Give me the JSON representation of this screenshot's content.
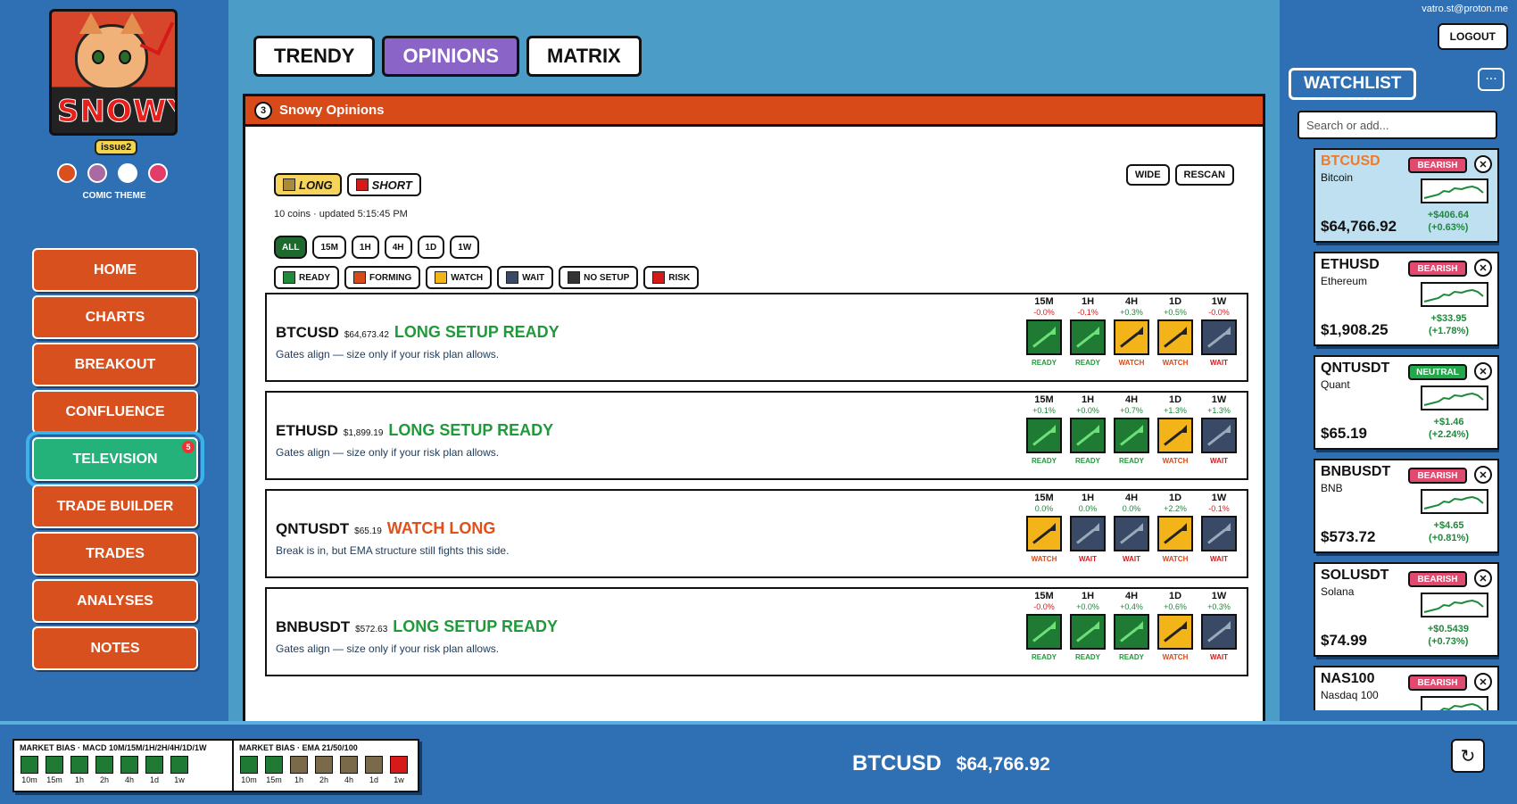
{
  "brand": {
    "logo_text": "SNOWY",
    "issue": "issue2",
    "theme_label": "COMIC THEME"
  },
  "theme_colors": [
    "#d9501f",
    "#a86aa0",
    "#ffffff",
    "#e33c6b"
  ],
  "nav": [
    {
      "label": "HOME"
    },
    {
      "label": "CHARTS"
    },
    {
      "label": "BREAKOUT"
    },
    {
      "label": "CONFLUENCE"
    },
    {
      "label": "TELEVISION",
      "active": true,
      "badge": "5"
    },
    {
      "label": "TRADE BUILDER"
    },
    {
      "label": "TRADES"
    },
    {
      "label": "ANALYSES"
    },
    {
      "label": "NOTES"
    }
  ],
  "tabs": [
    {
      "label": "TRENDY"
    },
    {
      "label": "OPINIONS",
      "active": true
    },
    {
      "label": "MATRIX"
    }
  ],
  "panel": {
    "number": "3",
    "title": "Snowy Opinions",
    "direction": {
      "long": "LONG",
      "short": "SHORT"
    },
    "wide_label": "WIDE",
    "rescan_label": "RESCAN",
    "meta": "10 coins · updated 5:15:45 PM",
    "timeframes": [
      "ALL",
      "15M",
      "1H",
      "4H",
      "1D",
      "1W"
    ],
    "filters": [
      {
        "label": "READY",
        "color": "#1f8a3a"
      },
      {
        "label": "FORMING",
        "color": "#d84a17"
      },
      {
        "label": "WATCH",
        "color": "#f3b41a"
      },
      {
        "label": "WAIT",
        "color": "#3a4a66"
      },
      {
        "label": "NO SETUP",
        "color": "#333333"
      },
      {
        "label": "RISK",
        "color": "#d61a1a"
      }
    ]
  },
  "state_colors": {
    "READY": "#1f7a33",
    "WATCH": "#f3b41a",
    "WAIT": "#3a4a66"
  },
  "coins": [
    {
      "symbol": "BTCUSD",
      "price": "$64,673.42",
      "status": "LONG SETUP READY",
      "status_color": "#1f9a3a",
      "desc": "Gates align — size only if your risk plan allows.",
      "tfs": [
        {
          "l": "15M",
          "p": "-0.0%",
          "s": "READY"
        },
        {
          "l": "1H",
          "p": "-0.1%",
          "s": "READY"
        },
        {
          "l": "4H",
          "p": "+0.3%",
          "s": "WATCH"
        },
        {
          "l": "1D",
          "p": "+0.5%",
          "s": "WATCH"
        },
        {
          "l": "1W",
          "p": "-0.0%",
          "s": "WAIT"
        }
      ]
    },
    {
      "symbol": "ETHUSD",
      "price": "$1,899.19",
      "status": "LONG SETUP READY",
      "status_color": "#1f9a3a",
      "desc": "Gates align — size only if your risk plan allows.",
      "tfs": [
        {
          "l": "15M",
          "p": "+0.1%",
          "s": "READY"
        },
        {
          "l": "1H",
          "p": "+0.0%",
          "s": "READY"
        },
        {
          "l": "4H",
          "p": "+0.7%",
          "s": "READY"
        },
        {
          "l": "1D",
          "p": "+1.3%",
          "s": "WATCH"
        },
        {
          "l": "1W",
          "p": "+1.3%",
          "s": "WAIT"
        }
      ]
    },
    {
      "symbol": "QNTUSDT",
      "price": "$65.19",
      "status": "WATCH LONG",
      "status_color": "#e2501a",
      "desc": "Break is in, but EMA structure still fights this side.",
      "tfs": [
        {
          "l": "15M",
          "p": "0.0%",
          "s": "WATCH"
        },
        {
          "l": "1H",
          "p": "0.0%",
          "s": "WAIT"
        },
        {
          "l": "4H",
          "p": "0.0%",
          "s": "WAIT"
        },
        {
          "l": "1D",
          "p": "+2.2%",
          "s": "WATCH"
        },
        {
          "l": "1W",
          "p": "-0.1%",
          "s": "WAIT"
        }
      ]
    },
    {
      "symbol": "BNBUSDT",
      "price": "$572.63",
      "status": "LONG SETUP READY",
      "status_color": "#1f9a3a",
      "desc": "Gates align — size only if your risk plan allows.",
      "tfs": [
        {
          "l": "15M",
          "p": "-0.0%",
          "s": "READY"
        },
        {
          "l": "1H",
          "p": "+0.0%",
          "s": "READY"
        },
        {
          "l": "4H",
          "p": "+0.4%",
          "s": "READY"
        },
        {
          "l": "1D",
          "p": "+0.6%",
          "s": "WATCH"
        },
        {
          "l": "1W",
          "p": "+0.3%",
          "s": "WAIT"
        }
      ]
    }
  ],
  "account": {
    "email": "vatro.st@proton.me",
    "logout": "LOGOUT"
  },
  "watchlist": {
    "title": "WATCHLIST",
    "more": "···",
    "search_placeholder": "Search or add...",
    "items": [
      {
        "symbol": "BTCUSD",
        "name": "Bitcoin",
        "badge": "BEARISH",
        "badge_color": "#e04a6f",
        "price": "$64,766.92",
        "chg1": "+$406.64",
        "chg2": "(+0.63%)",
        "selected": true
      },
      {
        "symbol": "ETHUSD",
        "name": "Ethereum",
        "badge": "BEARISH",
        "badge_color": "#e04a6f",
        "price": "$1,908.25",
        "chg1": "+$33.95",
        "chg2": "(+1.78%)"
      },
      {
        "symbol": "QNTUSDT",
        "name": "Quant",
        "badge": "NEUTRAL",
        "badge_color": "#22a84a",
        "price": "$65.19",
        "chg1": "+$1.46",
        "chg2": "(+2.24%)"
      },
      {
        "symbol": "BNBUSDT",
        "name": "BNB",
        "badge": "BEARISH",
        "badge_color": "#e04a6f",
        "price": "$573.72",
        "chg1": "+$4.65",
        "chg2": "(+0.81%)"
      },
      {
        "symbol": "SOLUSDT",
        "name": "Solana",
        "badge": "BEARISH",
        "badge_color": "#e04a6f",
        "price": "$74.99",
        "chg1": "+$0.5439",
        "chg2": "(+0.73%)"
      },
      {
        "symbol": "NAS100",
        "name": "Nasdaq 100",
        "badge": "BEARISH",
        "badge_color": "#e04a6f",
        "price": "",
        "chg1": "",
        "chg2": ""
      }
    ]
  },
  "bottom": {
    "macd": {
      "title": "MARKET BIAS · MACD 10M/15M/1H/2H/4H/1D/1W",
      "cells": [
        {
          "l": "10m",
          "c": "#1f7a33"
        },
        {
          "l": "15m",
          "c": "#1f7a33"
        },
        {
          "l": "1h",
          "c": "#1f7a33"
        },
        {
          "l": "2h",
          "c": "#1f7a33"
        },
        {
          "l": "4h",
          "c": "#1f7a33"
        },
        {
          "l": "1d",
          "c": "#1f7a33"
        },
        {
          "l": "1w",
          "c": "#1f7a33"
        }
      ]
    },
    "ema": {
      "title": "MARKET BIAS · EMA 21/50/100",
      "cells": [
        {
          "l": "10m",
          "c": "#1f7a33"
        },
        {
          "l": "15m",
          "c": "#1f7a33"
        },
        {
          "l": "1h",
          "c": "#7a6a4a"
        },
        {
          "l": "2h",
          "c": "#7a6a4a"
        },
        {
          "l": "4h",
          "c": "#7a6a4a"
        },
        {
          "l": "1d",
          "c": "#7a6a4a"
        },
        {
          "l": "1w",
          "c": "#d61a1a"
        }
      ]
    },
    "ticker_symbol": "BTCUSD",
    "ticker_price": "$64,766.92",
    "refresh_icon": "refresh-icon"
  }
}
